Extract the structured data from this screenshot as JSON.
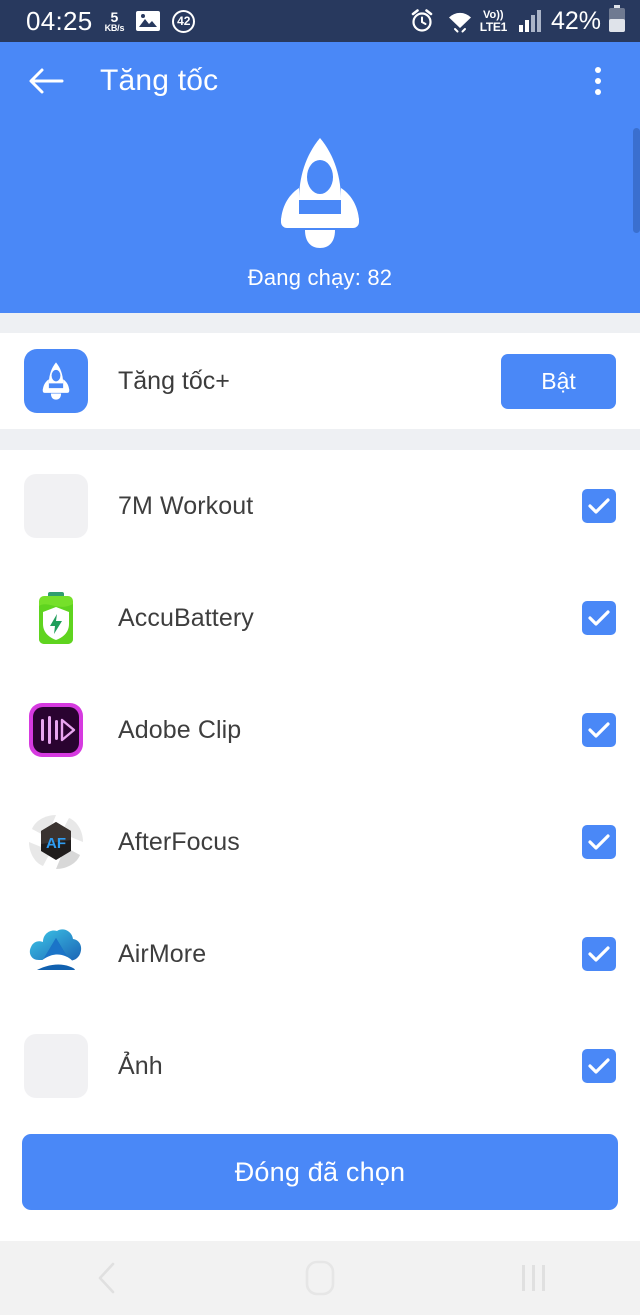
{
  "status_bar": {
    "time": "04:25",
    "net_speed_value": "5",
    "net_speed_unit": "KB/s",
    "image_icon": "image-icon",
    "badge_count": "42",
    "alarm_icon": "alarm-clock-icon",
    "wifi_icon": "wifi-icon",
    "volte_label": "Vo))",
    "network_label": "LTE1",
    "signal_icon": "signal-bars-icon",
    "battery_percent": "42%",
    "battery_icon": "battery-icon",
    "background_color": "#28395e"
  },
  "app_bar": {
    "back_icon": "back-arrow-icon",
    "title": "Tăng tốc",
    "overflow_icon": "more-vertical-icon",
    "background_color": "#4a88f7"
  },
  "hero": {
    "rocket_icon": "rocket-icon",
    "running_text": "Đang chạy: 82",
    "scrollbar": "scrollbar-thumb"
  },
  "boost": {
    "icon": "rocket-icon",
    "label": "Tăng tốc+",
    "button_label": "Bật",
    "accent_color": "#4a88f7"
  },
  "apps": [
    {
      "name": "7M Workout",
      "icon": "blank-app-icon",
      "checked": true
    },
    {
      "name": "AccuBattery",
      "icon": "accubattery-icon",
      "checked": true
    },
    {
      "name": "Adobe Clip",
      "icon": "adobe-clip-icon",
      "checked": true
    },
    {
      "name": "AfterFocus",
      "icon": "afterfocus-icon",
      "checked": true
    },
    {
      "name": "AirMore",
      "icon": "airmore-icon",
      "checked": true
    },
    {
      "name": "Ảnh",
      "icon": "blank-app-icon",
      "checked": true
    }
  ],
  "cta": {
    "label": "Đóng đã chọn"
  },
  "nav_bar": {
    "back_icon": "nav-back-icon",
    "home_icon": "nav-home-icon",
    "recents_icon": "nav-recents-icon"
  }
}
